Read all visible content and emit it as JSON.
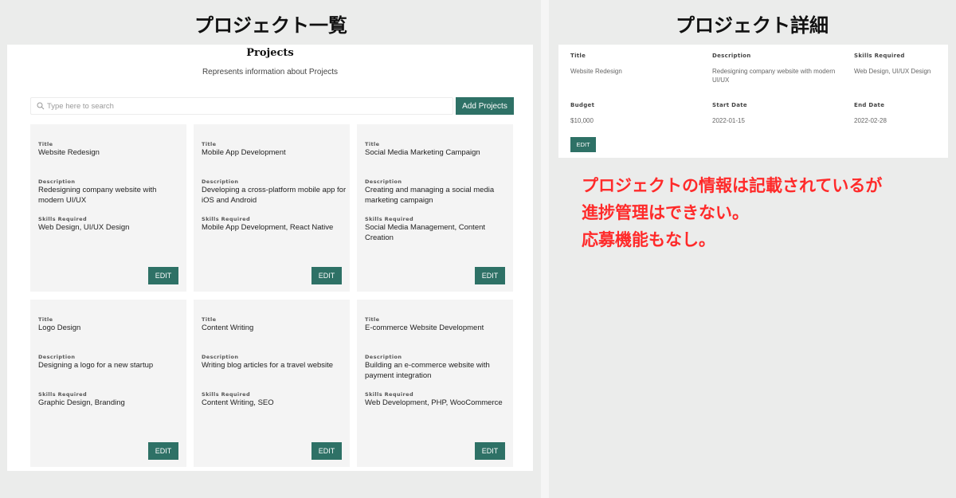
{
  "left_heading": "プロジェクト一覧",
  "right_heading": "プロジェクト詳細",
  "list": {
    "title": "Projects",
    "subtitle": "Represents information about Projects",
    "search_placeholder": "Type here to search",
    "add_button": "Add Projects",
    "labels": {
      "title": "Title",
      "description": "Description",
      "skills": "Skills Required"
    },
    "edit_label": "EDIT",
    "cards": [
      {
        "title": "Website Redesign",
        "description": "Redesigning company website with modern UI/UX",
        "skills": "Web Design, UI/UX Design"
      },
      {
        "title": "Mobile App Development",
        "description": "Developing a cross-platform mobile app for iOS and Android",
        "skills": "Mobile App Development, React Native"
      },
      {
        "title": "Social Media Marketing Campaign",
        "description": "Creating and managing a social media marketing campaign",
        "skills": "Social Media Management, Content Creation"
      },
      {
        "title": "Logo Design",
        "description": "Designing a logo for a new startup",
        "skills": "Graphic Design, Branding"
      },
      {
        "title": "Content Writing",
        "description": "Writing blog articles for a travel website",
        "skills": "Content Writing, SEO"
      },
      {
        "title": "E-commerce Website Development",
        "description": "Building an e-commerce website with payment integration",
        "skills": "Web Development, PHP, WooCommerce"
      }
    ]
  },
  "detail": {
    "labels": {
      "title": "Title",
      "description": "Description",
      "skills": "Skills Required",
      "budget": "Budget",
      "start_date": "Start Date",
      "end_date": "End Date"
    },
    "title": "Website Redesign",
    "description": "Redesigning company website with modern UI/UX",
    "skills": "Web Design, UI/UX Design",
    "budget": "$10,000",
    "start_date": "2022-01-15",
    "end_date": "2022-02-28",
    "edit_label": "EDIT"
  },
  "note": {
    "line1": "プロジェクトの情報は記載されているが",
    "line2": "進捗管理はできない。",
    "line3": "応募機能もなし。"
  },
  "colors": {
    "accent": "#2e7166",
    "note": "#ff2a2a",
    "card_bg": "#f4f4f4",
    "page_bg": "#ebeceb"
  }
}
